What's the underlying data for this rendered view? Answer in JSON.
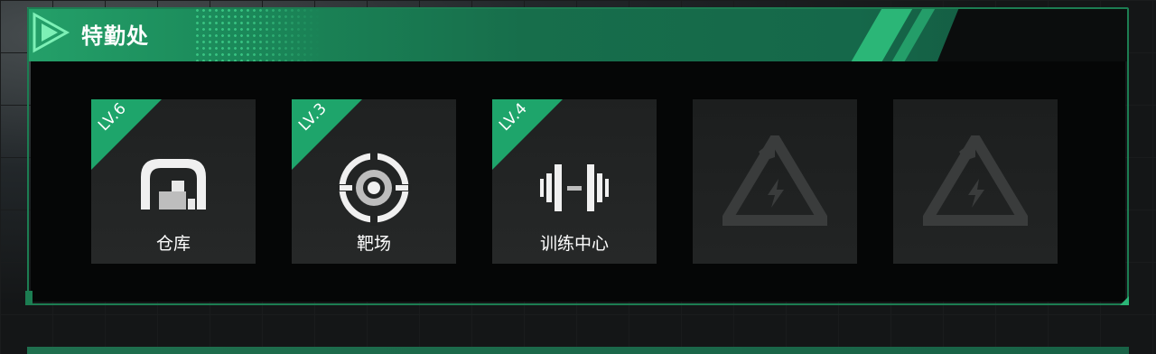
{
  "panel": {
    "title": "特勤处",
    "accent_color": "#1c7d52",
    "header_color": "#1b8a5a"
  },
  "facilities": [
    {
      "name": "仓库",
      "level": "LV.6",
      "icon": "warehouse-icon",
      "locked": false
    },
    {
      "name": "靶场",
      "level": "LV.3",
      "icon": "target-icon",
      "locked": false
    },
    {
      "name": "训练中心",
      "level": "LV.4",
      "icon": "dumbbell-icon",
      "locked": false
    },
    {
      "name": "",
      "level": "",
      "icon": "locked-slot-icon",
      "locked": true
    },
    {
      "name": "",
      "level": "",
      "icon": "locked-slot-icon",
      "locked": true
    }
  ]
}
